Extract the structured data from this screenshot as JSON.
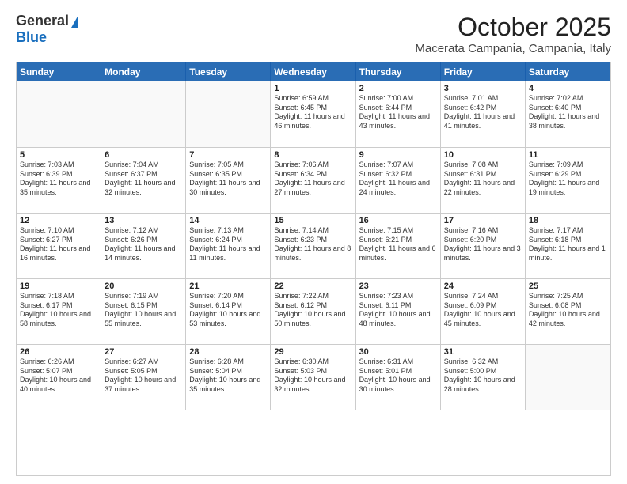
{
  "logo": {
    "general": "General",
    "blue": "Blue"
  },
  "title": "October 2025",
  "location": "Macerata Campania, Campania, Italy",
  "days": [
    "Sunday",
    "Monday",
    "Tuesday",
    "Wednesday",
    "Thursday",
    "Friday",
    "Saturday"
  ],
  "weeks": [
    [
      {
        "day": "",
        "text": "",
        "empty": true
      },
      {
        "day": "",
        "text": "",
        "empty": true
      },
      {
        "day": "",
        "text": "",
        "empty": true
      },
      {
        "day": "1",
        "text": "Sunrise: 6:59 AM\nSunset: 6:45 PM\nDaylight: 11 hours and 46 minutes."
      },
      {
        "day": "2",
        "text": "Sunrise: 7:00 AM\nSunset: 6:44 PM\nDaylight: 11 hours and 43 minutes."
      },
      {
        "day": "3",
        "text": "Sunrise: 7:01 AM\nSunset: 6:42 PM\nDaylight: 11 hours and 41 minutes."
      },
      {
        "day": "4",
        "text": "Sunrise: 7:02 AM\nSunset: 6:40 PM\nDaylight: 11 hours and 38 minutes."
      }
    ],
    [
      {
        "day": "5",
        "text": "Sunrise: 7:03 AM\nSunset: 6:39 PM\nDaylight: 11 hours and 35 minutes."
      },
      {
        "day": "6",
        "text": "Sunrise: 7:04 AM\nSunset: 6:37 PM\nDaylight: 11 hours and 32 minutes."
      },
      {
        "day": "7",
        "text": "Sunrise: 7:05 AM\nSunset: 6:35 PM\nDaylight: 11 hours and 30 minutes."
      },
      {
        "day": "8",
        "text": "Sunrise: 7:06 AM\nSunset: 6:34 PM\nDaylight: 11 hours and 27 minutes."
      },
      {
        "day": "9",
        "text": "Sunrise: 7:07 AM\nSunset: 6:32 PM\nDaylight: 11 hours and 24 minutes."
      },
      {
        "day": "10",
        "text": "Sunrise: 7:08 AM\nSunset: 6:31 PM\nDaylight: 11 hours and 22 minutes."
      },
      {
        "day": "11",
        "text": "Sunrise: 7:09 AM\nSunset: 6:29 PM\nDaylight: 11 hours and 19 minutes."
      }
    ],
    [
      {
        "day": "12",
        "text": "Sunrise: 7:10 AM\nSunset: 6:27 PM\nDaylight: 11 hours and 16 minutes."
      },
      {
        "day": "13",
        "text": "Sunrise: 7:12 AM\nSunset: 6:26 PM\nDaylight: 11 hours and 14 minutes."
      },
      {
        "day": "14",
        "text": "Sunrise: 7:13 AM\nSunset: 6:24 PM\nDaylight: 11 hours and 11 minutes."
      },
      {
        "day": "15",
        "text": "Sunrise: 7:14 AM\nSunset: 6:23 PM\nDaylight: 11 hours and 8 minutes."
      },
      {
        "day": "16",
        "text": "Sunrise: 7:15 AM\nSunset: 6:21 PM\nDaylight: 11 hours and 6 minutes."
      },
      {
        "day": "17",
        "text": "Sunrise: 7:16 AM\nSunset: 6:20 PM\nDaylight: 11 hours and 3 minutes."
      },
      {
        "day": "18",
        "text": "Sunrise: 7:17 AM\nSunset: 6:18 PM\nDaylight: 11 hours and 1 minute."
      }
    ],
    [
      {
        "day": "19",
        "text": "Sunrise: 7:18 AM\nSunset: 6:17 PM\nDaylight: 10 hours and 58 minutes."
      },
      {
        "day": "20",
        "text": "Sunrise: 7:19 AM\nSunset: 6:15 PM\nDaylight: 10 hours and 55 minutes."
      },
      {
        "day": "21",
        "text": "Sunrise: 7:20 AM\nSunset: 6:14 PM\nDaylight: 10 hours and 53 minutes."
      },
      {
        "day": "22",
        "text": "Sunrise: 7:22 AM\nSunset: 6:12 PM\nDaylight: 10 hours and 50 minutes."
      },
      {
        "day": "23",
        "text": "Sunrise: 7:23 AM\nSunset: 6:11 PM\nDaylight: 10 hours and 48 minutes."
      },
      {
        "day": "24",
        "text": "Sunrise: 7:24 AM\nSunset: 6:09 PM\nDaylight: 10 hours and 45 minutes."
      },
      {
        "day": "25",
        "text": "Sunrise: 7:25 AM\nSunset: 6:08 PM\nDaylight: 10 hours and 42 minutes."
      }
    ],
    [
      {
        "day": "26",
        "text": "Sunrise: 6:26 AM\nSunset: 5:07 PM\nDaylight: 10 hours and 40 minutes."
      },
      {
        "day": "27",
        "text": "Sunrise: 6:27 AM\nSunset: 5:05 PM\nDaylight: 10 hours and 37 minutes."
      },
      {
        "day": "28",
        "text": "Sunrise: 6:28 AM\nSunset: 5:04 PM\nDaylight: 10 hours and 35 minutes."
      },
      {
        "day": "29",
        "text": "Sunrise: 6:30 AM\nSunset: 5:03 PM\nDaylight: 10 hours and 32 minutes."
      },
      {
        "day": "30",
        "text": "Sunrise: 6:31 AM\nSunset: 5:01 PM\nDaylight: 10 hours and 30 minutes."
      },
      {
        "day": "31",
        "text": "Sunrise: 6:32 AM\nSunset: 5:00 PM\nDaylight: 10 hours and 28 minutes."
      },
      {
        "day": "",
        "text": "",
        "empty": true
      }
    ]
  ]
}
